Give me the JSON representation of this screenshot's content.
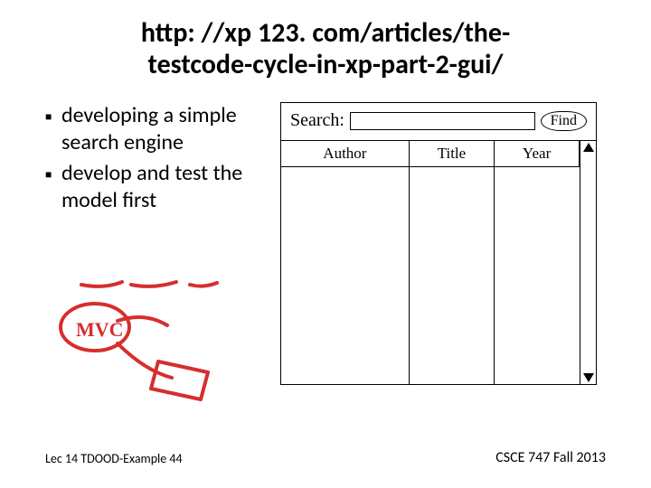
{
  "title": "http: //xp 123. com/articles/the-\ntestcode-cycle-in-xp-part-2-gui/",
  "bullets": [
    "developing a simple search engine",
    "develop and test the model first"
  ],
  "mock": {
    "searchLabel": "Search:",
    "findLabel": "Find",
    "headers": [
      "Author",
      "Title",
      "Year"
    ]
  },
  "footer": {
    "left": "Lec 14 TDOOD-Example 44",
    "right": "CSCE 747 Fall 2013"
  },
  "annotation": {
    "text": "MVC"
  }
}
